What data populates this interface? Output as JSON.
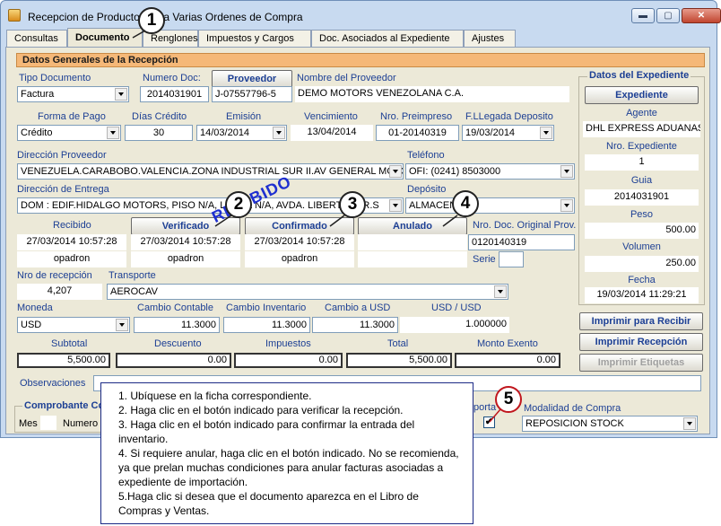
{
  "window": {
    "title": "Recepcion de Productos para Varias Ordenes de Compra",
    "minimize": "▬",
    "maximize": "▢",
    "close": "✕"
  },
  "tabs": [
    "Consultas",
    "Documento",
    "Renglones",
    "Impuestos y Cargos",
    "Doc. Asociados al Expediente",
    "Ajustes"
  ],
  "section_title": "Datos Generales de la Recepción",
  "doc": {
    "tipo_documento_label": "Tipo Documento",
    "tipo_documento": "Factura",
    "numero_doc_label": "Numero Doc:",
    "numero_doc": "2014031901",
    "proveedor_button": "Proveedor",
    "proveedor_rif": "J-07557796-5",
    "nombre_proveedor_label": "Nombre del Proveedor",
    "nombre_proveedor": "DEMO MOTORS VENEZOLANA C.A.",
    "forma_pago_label": "Forma de Pago",
    "forma_pago": "Crédito",
    "dias_credito_label": "Días Crédito",
    "dias_credito": "30",
    "emision_label": "Emisión",
    "emision": "14/03/2014",
    "vencimiento_label": "Vencimiento",
    "vencimiento": "13/04/2014",
    "nro_preimpreso_label": "Nro. Preimpreso",
    "nro_preimpreso": "01-20140319",
    "fllegada_label": "F.LLegada Deposito",
    "fllegada": "19/03/2014",
    "direccion_proveedor_label": "Dirección Proveedor",
    "direccion_proveedor": "VENEZUELA.CARABOBO.VALENCIA.ZONA INDUSTRIAL SUR II.AV GENERAL MOTORS",
    "telefono_label": "Teléfono",
    "telefono": "OFI: (0241) 8503000",
    "direccion_entrega_label": "Dirección de Entrega",
    "direccion_entrega": "DOM : EDIF.HIDALGO MOTORS, PISO N/A, LOCAL N/A, AVDA. LIBERTADOR.S",
    "deposito_label": "Depósito",
    "deposito": "ALMACEN",
    "recibido_label": "Recibido",
    "recibido_fecha": "27/03/2014 10:57:28",
    "recibido_user": "opadron",
    "verificado_button": "Verificado",
    "verificado_fecha": "27/03/2014 10:57:28",
    "verificado_user": "opadron",
    "confirmado_button": "Confirmado",
    "confirmado_fecha": "27/03/2014 10:57:28",
    "confirmado_user": "opadron",
    "anulado_button": "Anulado",
    "nro_doc_original_label": "Nro. Doc. Original Prov.",
    "nro_doc_original": "0120140319",
    "serie_label": "Serie",
    "nro_recepcion_label": "Nro de recepción",
    "nro_recepcion": "4,207",
    "transporte_label": "Transporte",
    "transporte": "AEROCAV",
    "moneda_label": "Moneda",
    "moneda": "USD",
    "cambio_contable_label": "Cambio Contable",
    "cambio_contable": "11.3000",
    "cambio_inventario_label": "Cambio Inventario",
    "cambio_inventario": "11.3000",
    "cambio_usd_label": "Cambio a USD",
    "cambio_usd": "11.3000",
    "usd_usd_label": "USD / USD",
    "usd_usd": "1.000000",
    "subtotal_label": "Subtotal",
    "subtotal": "5,500.00",
    "descuento_label": "Descuento",
    "descuento": "0.00",
    "impuestos_label": "Impuestos",
    "impuestos": "0.00",
    "total_label": "Total",
    "total": "5,500.00",
    "monto_exento_label": "Monto Exento",
    "monto_exento": "0.00",
    "observaciones_label": "Observaciones",
    "comprobante_label": "Comprobante Con",
    "mes_label": "Mes",
    "numero_label": "Numero",
    "soporta_label": "porta",
    "modalidad_label": "Modalidad de Compra",
    "modalidad": "REPOSICION STOCK"
  },
  "expediente": {
    "group_title": "Datos del Expediente",
    "button": "Expediente",
    "agente_label": "Agente",
    "agente": "DHL EXPRESS ADUANAS",
    "nro_expediente_label": "Nro. Expediente",
    "nro_expediente": "1",
    "guia_label": "Guia",
    "guia": "2014031901",
    "peso_label": "Peso",
    "peso": "500.00",
    "volumen_label": "Volumen",
    "volumen": "250.00",
    "fecha_label": "Fecha",
    "fecha": "19/03/2014 11:29:21"
  },
  "actions": {
    "imprimir_recibir": "Imprimir para Recibir",
    "imprimir_recepcion": "Imprimir Recepción",
    "imprimir_etiquetas": "Imprimir Etiquetas"
  },
  "stamp": "RECIBIDO",
  "markers": [
    "1",
    "2",
    "3",
    "4",
    "5"
  ],
  "instructions": [
    "1. Ubíquese en la ficha correspondiente.",
    "2. Haga clic en el botón indicado para verificar la recepción.",
    "3. Haga clic en el botón indicado para confirmar la entrada del inventario.",
    "4. Si requiere anular, haga clic en el botón indicado. No se recomienda, ya que prelan muchas condiciones para anular facturas asociadas a expediente de importación.",
    "5.Haga clic si desea que el documento aparezca en el Libro de Compras y Ventas."
  ],
  "checkbox_mark": "✔"
}
